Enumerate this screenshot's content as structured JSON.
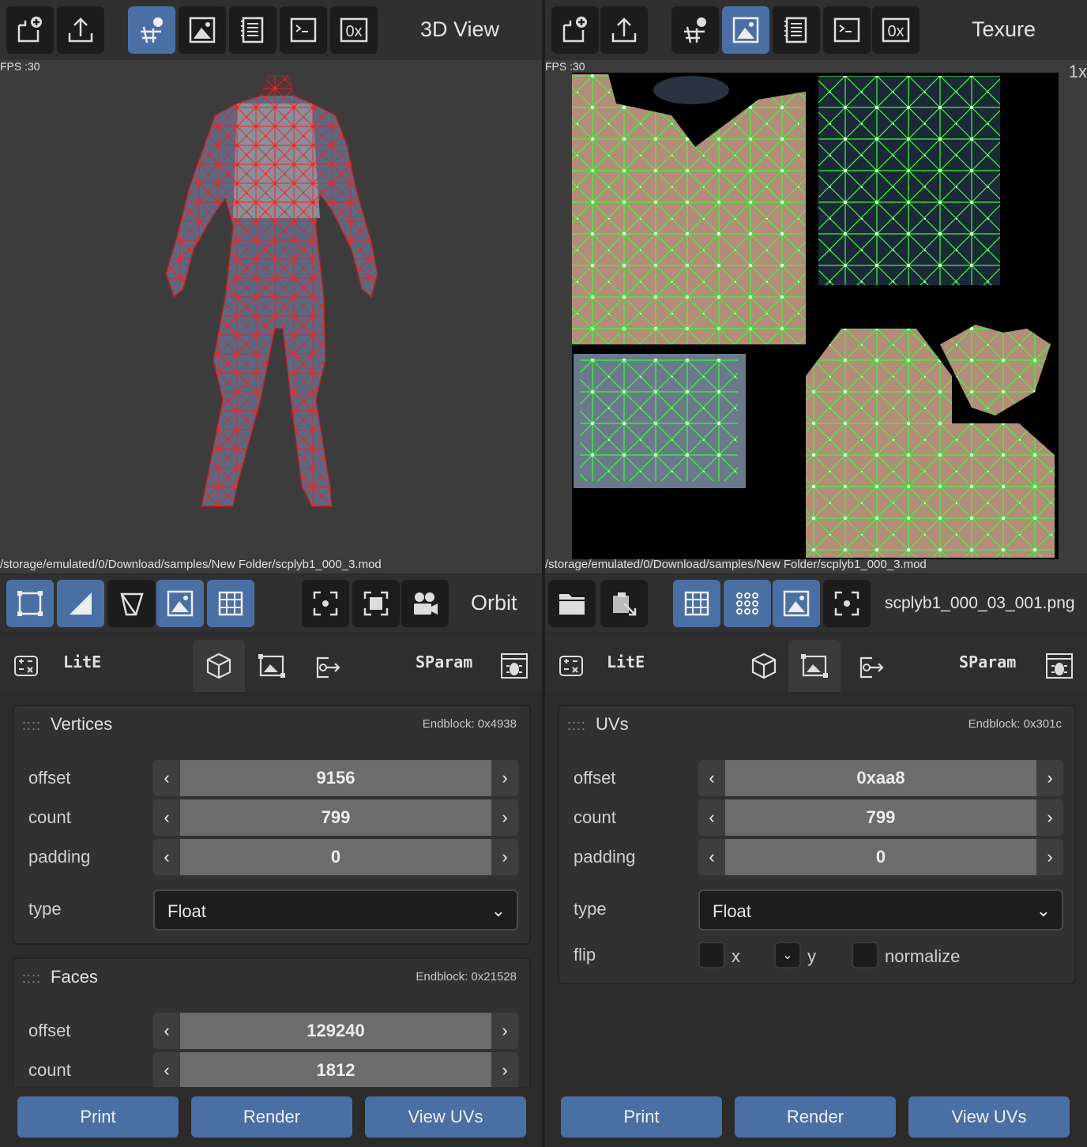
{
  "left": {
    "toolbar": {
      "title": "3D View",
      "icons": [
        "new-file-icon",
        "upload-icon",
        "skeleton-icon",
        "image-icon",
        "notes-icon",
        "terminal-icon",
        "hex-icon"
      ],
      "active": "skeleton-icon"
    },
    "fps": "FPS :30",
    "path": "/storage/emulated/0/Download/samples/New Folder/scplyb1_000_3.mod",
    "viewport_toolbar": {
      "icons": [
        "bounding-box-icon",
        "shading-icon",
        "wireframe-icon",
        "texture-icon",
        "grid-icon",
        "focus-icon",
        "fit-icon",
        "camera-icon"
      ],
      "active": [
        "bounding-box-icon",
        "shading-icon",
        "texture-icon",
        "grid-icon"
      ],
      "mode": "Orbit"
    },
    "tabs": {
      "lite": "LitE",
      "sparam": "SParam",
      "icons": [
        "variables-icon",
        "cube-icon",
        "image-tab-icon",
        "export-icon",
        "debug-icon"
      ],
      "active": "cube-icon"
    },
    "vertices": {
      "title": "Vertices",
      "endblock": "Endblock: 0x4938",
      "offset_label": "offset",
      "offset": "9156",
      "count_label": "count",
      "count": "799",
      "padding_label": "padding",
      "padding": "0",
      "type_label": "type",
      "type": "Float"
    },
    "faces": {
      "title": "Faces",
      "endblock": "Endblock: 0x21528",
      "offset_label": "offset",
      "offset": "129240",
      "count_label": "count",
      "count": "1812"
    },
    "buttons": {
      "print": "Print",
      "render": "Render",
      "view_uvs": "View UVs"
    }
  },
  "right": {
    "toolbar": {
      "title": "Texure",
      "icons": [
        "new-file-icon",
        "upload-icon",
        "skeleton-icon",
        "image-icon",
        "notes-icon",
        "terminal-icon",
        "hex-icon"
      ],
      "active": "image-icon"
    },
    "fps": "FPS :30",
    "zoom": "1x",
    "path": "/storage/emulated/0/Download/samples/New Folder/scplyb1_000_3.mod",
    "viewport_toolbar": {
      "icons": [
        "folder-icon",
        "import-icon",
        "grid-icon",
        "points-icon",
        "texture-icon",
        "focus-icon"
      ],
      "active": [
        "grid-icon",
        "points-icon",
        "texture-icon"
      ],
      "file": "scplyb1_000_03_001.png"
    },
    "tabs": {
      "lite": "LitE",
      "sparam": "SParam",
      "icons": [
        "variables-icon",
        "cube-icon",
        "image-tab-icon",
        "export-icon",
        "debug-icon"
      ],
      "active": "image-tab-icon"
    },
    "uvs": {
      "title": "UVs",
      "endblock": "Endblock: 0x301c",
      "offset_label": "offset",
      "offset": "0xaa8",
      "count_label": "count",
      "count": "799",
      "padding_label": "padding",
      "padding": "0",
      "type_label": "type",
      "type": "Float",
      "flip_label": "flip",
      "x_label": "x",
      "y_label": "y",
      "normalize_label": "normalize",
      "y_checked": true
    },
    "buttons": {
      "print": "Print",
      "render": "Render",
      "view_uvs": "View UVs"
    }
  },
  "colors": {
    "accent": "#4a6fa5",
    "wire_3d": "#ff1a1a",
    "wire_uv": "#33ff33",
    "skin": "#b38c7a",
    "denim": "#3d5570"
  }
}
